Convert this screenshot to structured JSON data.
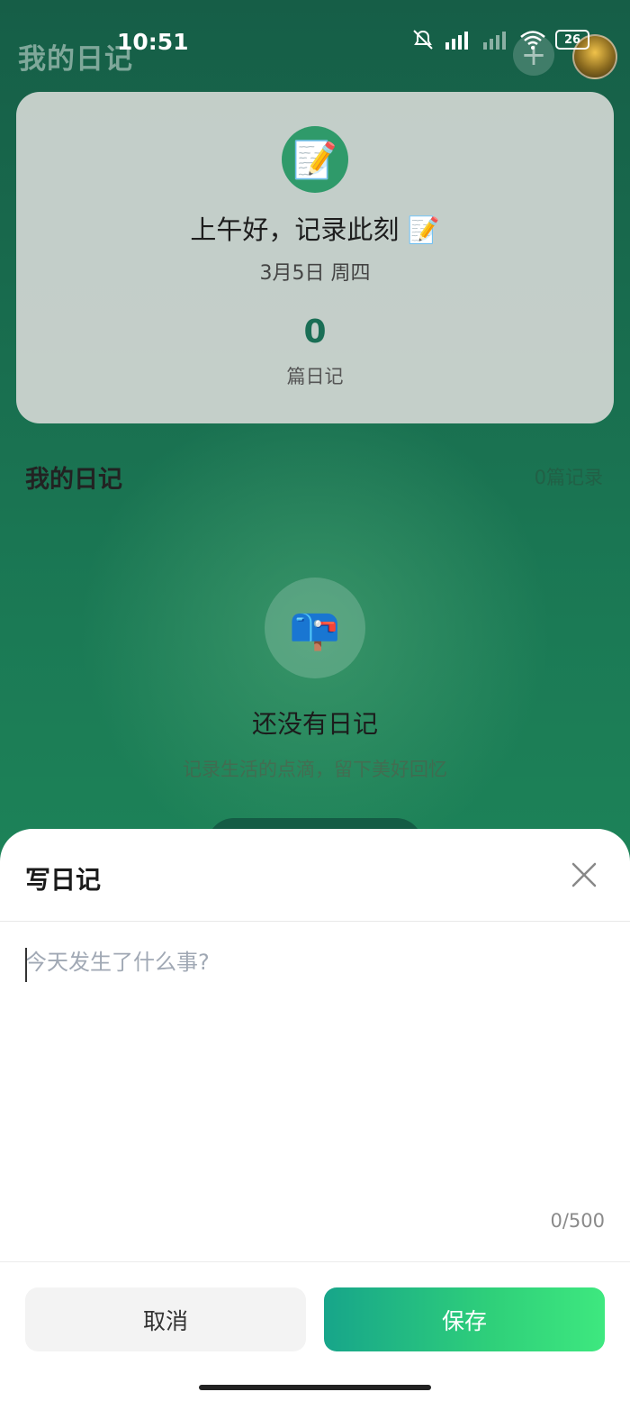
{
  "status_bar": {
    "time": "10:51",
    "battery": "26"
  },
  "header": {
    "title": "我的日记",
    "add_icon": "+"
  },
  "summary_card": {
    "greeting": "上午好，记录此刻 📝",
    "date": "3月5日 周四",
    "count": "0",
    "count_label": "篇日记",
    "icon": "📝"
  },
  "list_section": {
    "title": "我的日记",
    "count_text": "0篇记录"
  },
  "empty_state": {
    "icon": "📪",
    "title": "还没有日记",
    "subtitle": "记录生活的点滴，留下美好回忆"
  },
  "sheet": {
    "title": "写日记",
    "placeholder": "今天发生了什么事?",
    "char_count": "0/500",
    "cancel_label": "取消",
    "save_label": "保存"
  },
  "colors": {
    "accent_start": "#17a58a",
    "accent_end": "#3ee87f",
    "background": "#1b7a55"
  }
}
